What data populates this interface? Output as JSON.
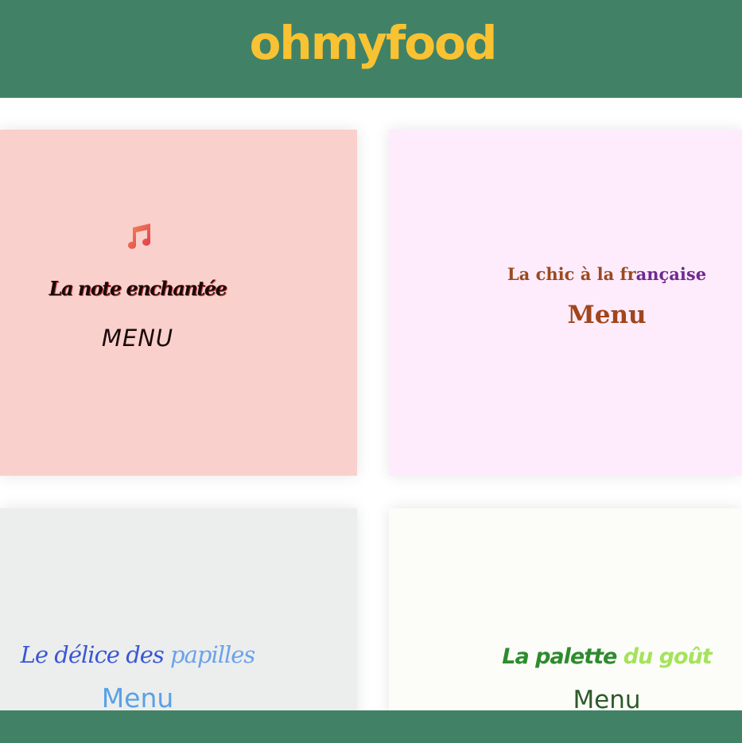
{
  "header": {
    "logo": "ohmyfood"
  },
  "restaurants": [
    {
      "icon": "music-note-icon",
      "title": "La note enchantée",
      "menu_label": "MENU",
      "background": "#f9d0cb"
    },
    {
      "title_part1": "La chic à la fr",
      "title_part2": "ançaise",
      "menu_label": "Menu",
      "background": "#feecfd"
    },
    {
      "title_part1": "Le délice des ",
      "title_part2": "papilles",
      "menu_label": "Menu",
      "background": "#eceeed"
    },
    {
      "title_part1": "La palette ",
      "title_part2": "du goût",
      "menu_label": "Menu",
      "background": "#fcfdf9"
    }
  ],
  "colors": {
    "header_bg": "#418267",
    "logo": "#f9c232",
    "footer_bg": "#418267"
  }
}
